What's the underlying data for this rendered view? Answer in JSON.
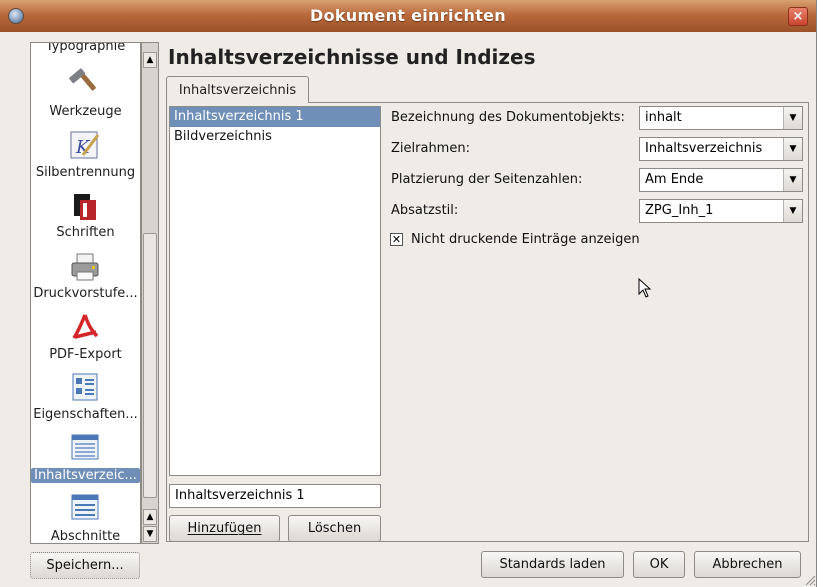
{
  "window": {
    "title": "Dokument einrichten",
    "close_glyph": "×"
  },
  "sidebar": {
    "items": [
      {
        "label": "Typographie",
        "icon": "typography-icon"
      },
      {
        "label": "Werkzeuge",
        "icon": "hammer-tools-icon"
      },
      {
        "label": "Silbentrennung",
        "icon": "hyphenation-icon"
      },
      {
        "label": "Schriften",
        "icon": "font-icon"
      },
      {
        "label": "Druckvorstufe...",
        "icon": "printer-icon"
      },
      {
        "label": "PDF-Export",
        "icon": "pdf-icon"
      },
      {
        "label": "Eigenschaften...",
        "icon": "document-properties-icon"
      },
      {
        "label": "Inhaltsverzeic...",
        "icon": "table-of-contents-icon",
        "selected": true
      },
      {
        "label": "Abschnitte",
        "icon": "sections-icon"
      }
    ]
  },
  "main": {
    "heading": "Inhaltsverzeichnisse und Indizes",
    "tab_label": "Inhaltsverzeichnis",
    "list_items": [
      "Inhaltsverzeichnis 1",
      "Bildverzeichnis"
    ],
    "selected_list_item": "Inhaltsverzeichnis 1",
    "name_value": "Inhaltsverzeichnis 1",
    "add_button": "Hinzufügen",
    "delete_button": "Löschen",
    "fields": {
      "object_name_label": "Bezeichnung des Dokumentobjekts:",
      "object_name_value": "inhalt",
      "target_frame_label": "Zielrahmen:",
      "target_frame_value": "Inhaltsverzeichnis",
      "page_number_label": "Platzierung der Seitenzahlen:",
      "page_number_value": "Am Ende",
      "paragraph_style_label": "Absatzstil:",
      "paragraph_style_value": "ZPG_Inh_1"
    },
    "checkbox_label": "Nicht druckende Einträge anzeigen",
    "checkbox_checked": true
  },
  "footer": {
    "save_button": "Speichern...",
    "defaults_button": "Standards laden",
    "ok_button": "OK",
    "cancel_button": "Abbrechen"
  }
}
